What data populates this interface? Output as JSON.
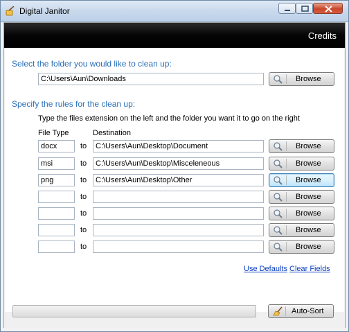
{
  "window": {
    "title": "Digital Janitor"
  },
  "header": {
    "credits_label": "Credits"
  },
  "source": {
    "label": "Select the folder you would like to clean up:",
    "path": "C:\\Users\\Aun\\Downloads",
    "browse_label": "Browse"
  },
  "rules": {
    "label": "Specify the rules for the clean up:",
    "hint": "Type the files extension on the left and the folder you want it to go on the right",
    "col_filetype": "File Type",
    "col_destination": "Destination",
    "to_label": "to",
    "browse_label": "Browse",
    "rows": [
      {
        "ext": "docx",
        "dest": "C:\\Users\\Aun\\Desktop\\Document"
      },
      {
        "ext": "msi",
        "dest": "C:\\Users\\Aun\\Desktop\\Misceleneous"
      },
      {
        "ext": "png",
        "dest": "C:\\Users\\Aun\\Desktop\\Other"
      },
      {
        "ext": "",
        "dest": ""
      },
      {
        "ext": "",
        "dest": ""
      },
      {
        "ext": "",
        "dest": ""
      },
      {
        "ext": "",
        "dest": ""
      }
    ]
  },
  "links": {
    "use_defaults": "Use Defaults",
    "clear_fields": "Clear Fields"
  },
  "footer": {
    "autosort_label": "Auto-Sort",
    "progress": 0
  },
  "colors": {
    "section_label": "#2a6fb8",
    "link": "#0a3dbd"
  }
}
